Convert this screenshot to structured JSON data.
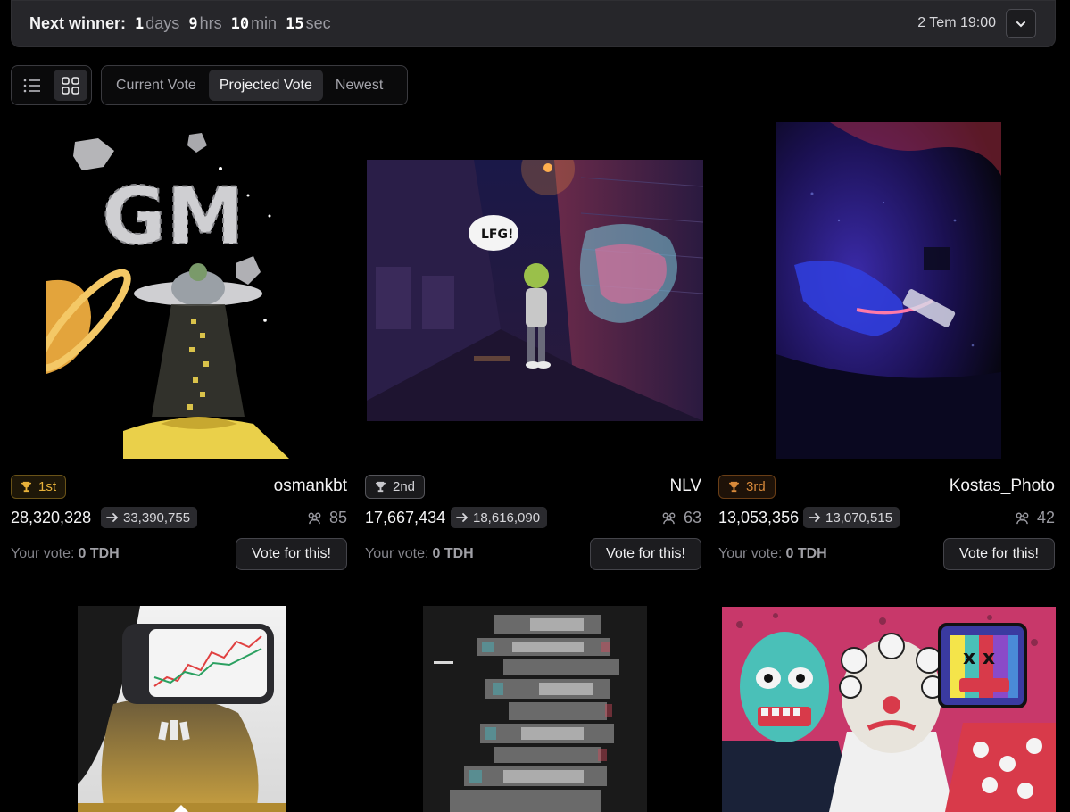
{
  "header": {
    "label": "Next winner:",
    "countdown": [
      {
        "value": "1",
        "unit": "days"
      },
      {
        "value": "9",
        "unit": "hrs"
      },
      {
        "value": "10",
        "unit": "min"
      },
      {
        "value": "15",
        "unit": "sec"
      }
    ],
    "date": "2 Tem 19:00",
    "dropdown_icon": "chevron-down-icon"
  },
  "view_toggle": {
    "list_icon": "list-icon",
    "grid_icon": "grid-icon",
    "active": "grid"
  },
  "sort_tabs": [
    {
      "label": "Current Vote",
      "active": false
    },
    {
      "label": "Projected Vote",
      "active": true
    },
    {
      "label": "Newest",
      "active": false
    }
  ],
  "cards": [
    {
      "rank": "1st",
      "creator": "osmankbt",
      "votes": "28,320,328",
      "projected": "33,390,755",
      "voters": "85",
      "your_vote_label": "Your vote:",
      "your_vote_value": "0 TDH",
      "vote_button": "Vote for this!"
    },
    {
      "rank": "2nd",
      "creator": "NLV",
      "votes": "17,667,434",
      "projected": "18,616,090",
      "voters": "63",
      "your_vote_label": "Your vote:",
      "your_vote_value": "0 TDH",
      "vote_button": "Vote for this!"
    },
    {
      "rank": "3rd",
      "creator": "Kostas_Photo",
      "votes": "13,053,356",
      "projected": "13,070,515",
      "voters": "42",
      "your_vote_label": "Your vote:",
      "your_vote_value": "0 TDH",
      "vote_button": "Vote for this!"
    }
  ],
  "colors": {
    "gold": "#e8b23a",
    "silver": "#c8c8cc",
    "bronze": "#d98a3a"
  }
}
